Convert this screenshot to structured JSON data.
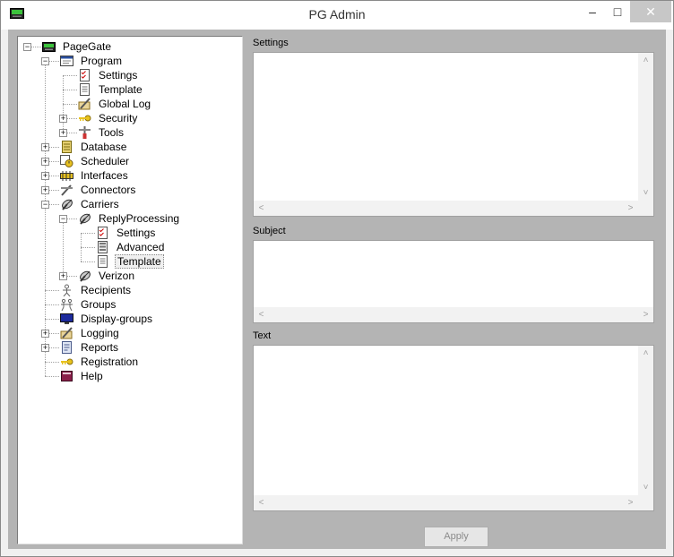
{
  "window": {
    "title": "PG Admin",
    "minimize_glyph": "‒",
    "maximize_glyph": "□",
    "close_glyph": "✕"
  },
  "tree": [
    {
      "label": "PageGate",
      "icon": "pager-icon",
      "expander": "−"
    },
    {
      "label": "Program",
      "icon": "program-window-icon",
      "expander": "−"
    },
    {
      "label": "Settings",
      "icon": "checklist-icon"
    },
    {
      "label": "Template",
      "icon": "document-icon"
    },
    {
      "label": "Global Log",
      "icon": "log-pen-icon"
    },
    {
      "label": "Security",
      "icon": "key-icon",
      "expander": "+"
    },
    {
      "label": "Tools",
      "icon": "tools-icon",
      "expander": "+"
    },
    {
      "label": "Database",
      "icon": "database-icon",
      "expander": "+"
    },
    {
      "label": "Scheduler",
      "icon": "scheduler-icon",
      "expander": "+"
    },
    {
      "label": "Interfaces",
      "icon": "interfaces-icon",
      "expander": "+"
    },
    {
      "label": "Connectors",
      "icon": "connectors-icon",
      "expander": "+"
    },
    {
      "label": "Carriers",
      "icon": "satellite-icon",
      "expander": "−"
    },
    {
      "label": "ReplyProcessing",
      "icon": "satellite-icon",
      "expander": "−"
    },
    {
      "label": "Settings",
      "icon": "checklist-icon"
    },
    {
      "label": "Advanced",
      "icon": "advanced-icon"
    },
    {
      "label": "Template",
      "icon": "document-icon",
      "selected": true
    },
    {
      "label": "Verizon",
      "icon": "satellite-icon",
      "expander": "+"
    },
    {
      "label": "Recipients",
      "icon": "person-icon"
    },
    {
      "label": "Groups",
      "icon": "group-icon"
    },
    {
      "label": "Display-groups",
      "icon": "monitor-icon"
    },
    {
      "label": "Logging",
      "icon": "log-pen-icon",
      "expander": "+"
    },
    {
      "label": "Reports",
      "icon": "reports-icon",
      "expander": "+"
    },
    {
      "label": "Registration",
      "icon": "key-icon"
    },
    {
      "label": "Help",
      "icon": "help-book-icon"
    }
  ],
  "panel": {
    "settings_label": "Settings",
    "subject_label": "Subject",
    "text_label": "Text",
    "apply_label": "Apply"
  },
  "scroll_glyphs": {
    "up": "˄",
    "down": "˅",
    "left": "˂",
    "right": "˃"
  }
}
